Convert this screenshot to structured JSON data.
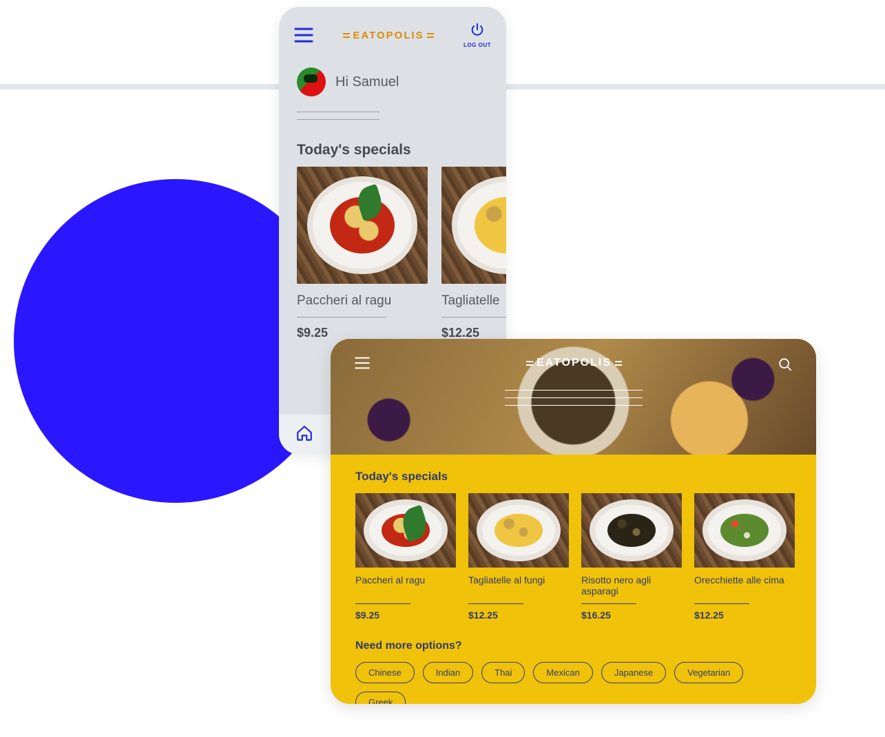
{
  "brand": "EATOPOLIS",
  "mobile": {
    "logout_label": "LOG OUT",
    "greeting": "Hi Samuel",
    "section_title": "Today's specials",
    "cards": [
      {
        "name": "Paccheri al ragu",
        "price": "$9.25"
      },
      {
        "name": "Tagliatelle",
        "price": "$12.25"
      }
    ]
  },
  "tablet": {
    "section_title": "Today's specials",
    "cards": [
      {
        "name": "Paccheri al ragu",
        "price": "$9.25"
      },
      {
        "name": "Tagliatelle al fungi",
        "price": "$12.25"
      },
      {
        "name": "Risotto nero agli asparagi",
        "price": "$16.25"
      },
      {
        "name": "Orecchiette alle cima",
        "price": "$12.25"
      }
    ],
    "options_title": "Need more options?",
    "chips": [
      "Chinese",
      "Indian",
      "Thai",
      "Mexican",
      "Japanese",
      "Vegetarian",
      "Greek"
    ]
  }
}
